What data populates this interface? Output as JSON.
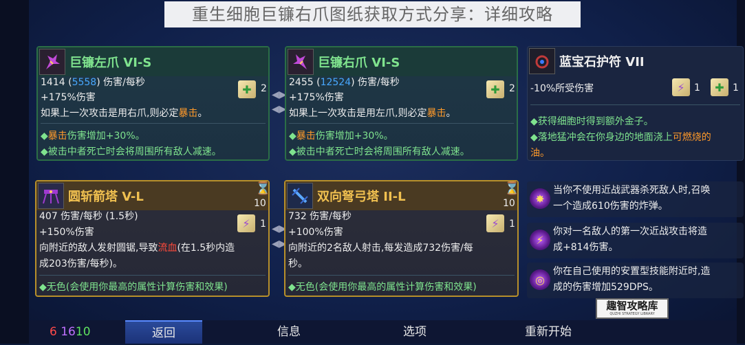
{
  "banner": "重生细胞巨镰右爪图纸获取方式分享：详细攻略",
  "cards": [
    {
      "title": "巨镰左爪 VI-S",
      "dps_base": "1414",
      "dps_paren": "5558",
      "dps_unit": "伤害/每秒",
      "bonus": "+175%伤害",
      "scroll_count": "2",
      "desc_pre": "如果上一次攻击是用右爪,则必定",
      "desc_em": "暴击",
      "desc_post": "。",
      "b1_em": "暴击",
      "b1_rest": "伤害增加+30%。",
      "b2": "被击中者死亡时会将周围所有敌人减速。"
    },
    {
      "title": "巨镰右爪 VI-S",
      "dps_base": "2455",
      "dps_paren": "12524",
      "dps_unit": "伤害/每秒",
      "bonus": "+175%伤害",
      "scroll_count": "2",
      "desc_pre": "如果上一次攻击是用左爪,则必定",
      "desc_em": "暴击",
      "desc_post": "。",
      "b1_em": "暴击",
      "b1_rest": "伤害增加+30%。",
      "b2": "被击中者死亡时会将周围所有敌人减速。"
    },
    {
      "title": "圆斩箭塔 V-L",
      "stat": "407 伤害/每秒 (1.5秒)",
      "bonus": "+150%伤害",
      "scroll_count": "1",
      "timer": "10",
      "desc1_pre": "向附近的敌人发射圆锯,导致",
      "desc1_em": "流血",
      "desc1_post": "(在1.5秒内造",
      "desc2": "成203伤害/每秒)。",
      "b1": "无色(会使用你最高的属性计算伤害和效果)"
    },
    {
      "title": "双向弩弓塔 II-L",
      "stat": "732 伤害/每秒",
      "bonus": "+100%伤害",
      "scroll_count": "1",
      "timer": "10",
      "desc1": "向附近的2名敌人射击,每发造成732伤害/每",
      "desc2": "秒。",
      "b1": "无色(会使用你最高的属性计算伤害和效果)"
    }
  ],
  "amulet": {
    "title": "蓝宝石护符 VII",
    "stat": "-10%所受伤害",
    "purple_count": "1",
    "green_count": "1",
    "b1": "获得细胞时得到额外金子。",
    "b2_pre": "落地猛冲会在你身边的地面浇上",
    "b2_em": "可燃烧的",
    "b2_post": "油。"
  },
  "mutations": [
    {
      "line1": "当你不使用近战武器杀死敌人时,召唤",
      "line2": "一个造成610伤害的炸弹。",
      "icon": "bomb-icon"
    },
    {
      "line1": "你对一名敌人的第一次近战攻击将造",
      "line2": "成+814伤害。",
      "icon": "lightning-icon"
    },
    {
      "line1": "你在自己使用的安置型技能附近时,造",
      "line2": "成的伤害增加529DPS。",
      "icon": "orb-icon"
    }
  ],
  "stats": {
    "brutality": "6",
    "tactics": "16",
    "survival": "10"
  },
  "menu": {
    "back": "返回",
    "info": "信息",
    "options": "选项",
    "restart": "重新开始"
  },
  "watermark": {
    "main": "趣智攻略库",
    "sub": "QUZHI STRATEGY LIBRARY"
  },
  "colors": {
    "brutality": "#ff4a4a",
    "tactics": "#c070ff",
    "survival": "#5fe35f",
    "legendary_border": "#b8902a",
    "item_border": "#2b6e46"
  }
}
